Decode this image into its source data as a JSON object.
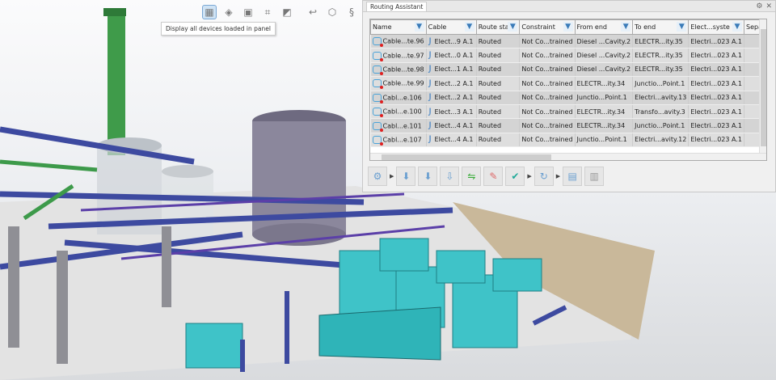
{
  "viewport_toolbar": {
    "icons": [
      "display-devices-icon",
      "place-device-icon",
      "panel-view-icon",
      "connection-matrix-icon",
      "filter-devices-icon",
      "route-icon",
      "part-icon",
      "harness-icon",
      "settings-icon"
    ],
    "tooltip": "Display all devices loaded in panel"
  },
  "panel": {
    "title": "Routing Assistant",
    "columns": [
      "Name",
      "Cable",
      "Route stat",
      "Constraint",
      "From end",
      "To end",
      "Elect...syste",
      "Sepa"
    ],
    "rows": [
      [
        "Cable...te.96",
        "Elect...9 A.1",
        "Routed",
        "Not Co...trained",
        "Diesel ...Cavity.2",
        "ELECTR...ity.35",
        "Electri...023 A.1",
        ""
      ],
      [
        "Cable...te.97",
        "Elect...0 A.1",
        "Routed",
        "Not Co...trained",
        "Diesel ...Cavity.2",
        "ELECTR...ity.35",
        "Electri...023 A.1",
        ""
      ],
      [
        "Cable...te.98",
        "Elect...1 A.1",
        "Routed",
        "Not Co...trained",
        "Diesel ...Cavity.2",
        "ELECTR...ity.35",
        "Electri...023 A.1",
        ""
      ],
      [
        "Cable...te.99",
        "Elect...2 A.1",
        "Routed",
        "Not Co...trained",
        "ELECTR...ity.34",
        "Junctio...Point.1",
        "Electri...023 A.1",
        ""
      ],
      [
        "Cabl...e.106",
        "Elect...2 A.1",
        "Routed",
        "Not Co...trained",
        "Junctio...Point.1",
        "Electri...avity.13",
        "Electri...023 A.1",
        ""
      ],
      [
        "Cabl...e.100",
        "Elect...3 A.1",
        "Routed",
        "Not Co...trained",
        "ELECTR...ity.34",
        "Transfo...avity.3",
        "Electri...023 A.1",
        ""
      ],
      [
        "Cabl...e.101",
        "Elect...4 A.1",
        "Routed",
        "Not Co...trained",
        "ELECTR...ity.34",
        "Junctio...Point.1",
        "Electri...023 A.1",
        ""
      ],
      [
        "Cabl...e.107",
        "Elect...4 A.1",
        "Routed",
        "Not Co...trained",
        "Junctio...Point.1",
        "Electri...avity.12",
        "Electri...023 A.1",
        ""
      ]
    ]
  }
}
